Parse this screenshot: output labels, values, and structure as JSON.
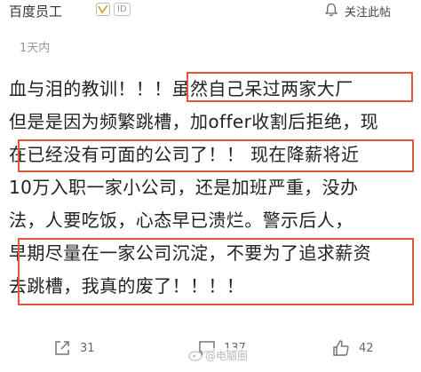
{
  "header": {
    "username": "百度员工",
    "id_badge": "ID",
    "follow_label": "关注此帖",
    "icons": {
      "verified": "v-badge-icon",
      "bell": "bell-icon"
    }
  },
  "post": {
    "time": "1天内",
    "lines": [
      "血与泪的教训！！！虽然自己呆过两家大厂",
      "但是是因为频繁跳槽，加offer收割后拒绝，现",
      "在已经没有可面的公司了！！ 现在降薪将近",
      "10万入职一家小公司，还是加班严重，没办",
      "法，人要吃饭，心态早已溃烂。警示后人，",
      "早期尽量在一家公司沉淀，不要为了追求薪资",
      "去跳槽，我真的废了！！！！"
    ],
    "highlight_color": "#e2563a"
  },
  "footer": {
    "share_count": "31",
    "comment_count": "137",
    "like_count": "42",
    "watermark": "@电脑圈",
    "icons": {
      "share": "share-icon",
      "comment": "comment-icon",
      "like": "thumbs-up-icon"
    }
  }
}
